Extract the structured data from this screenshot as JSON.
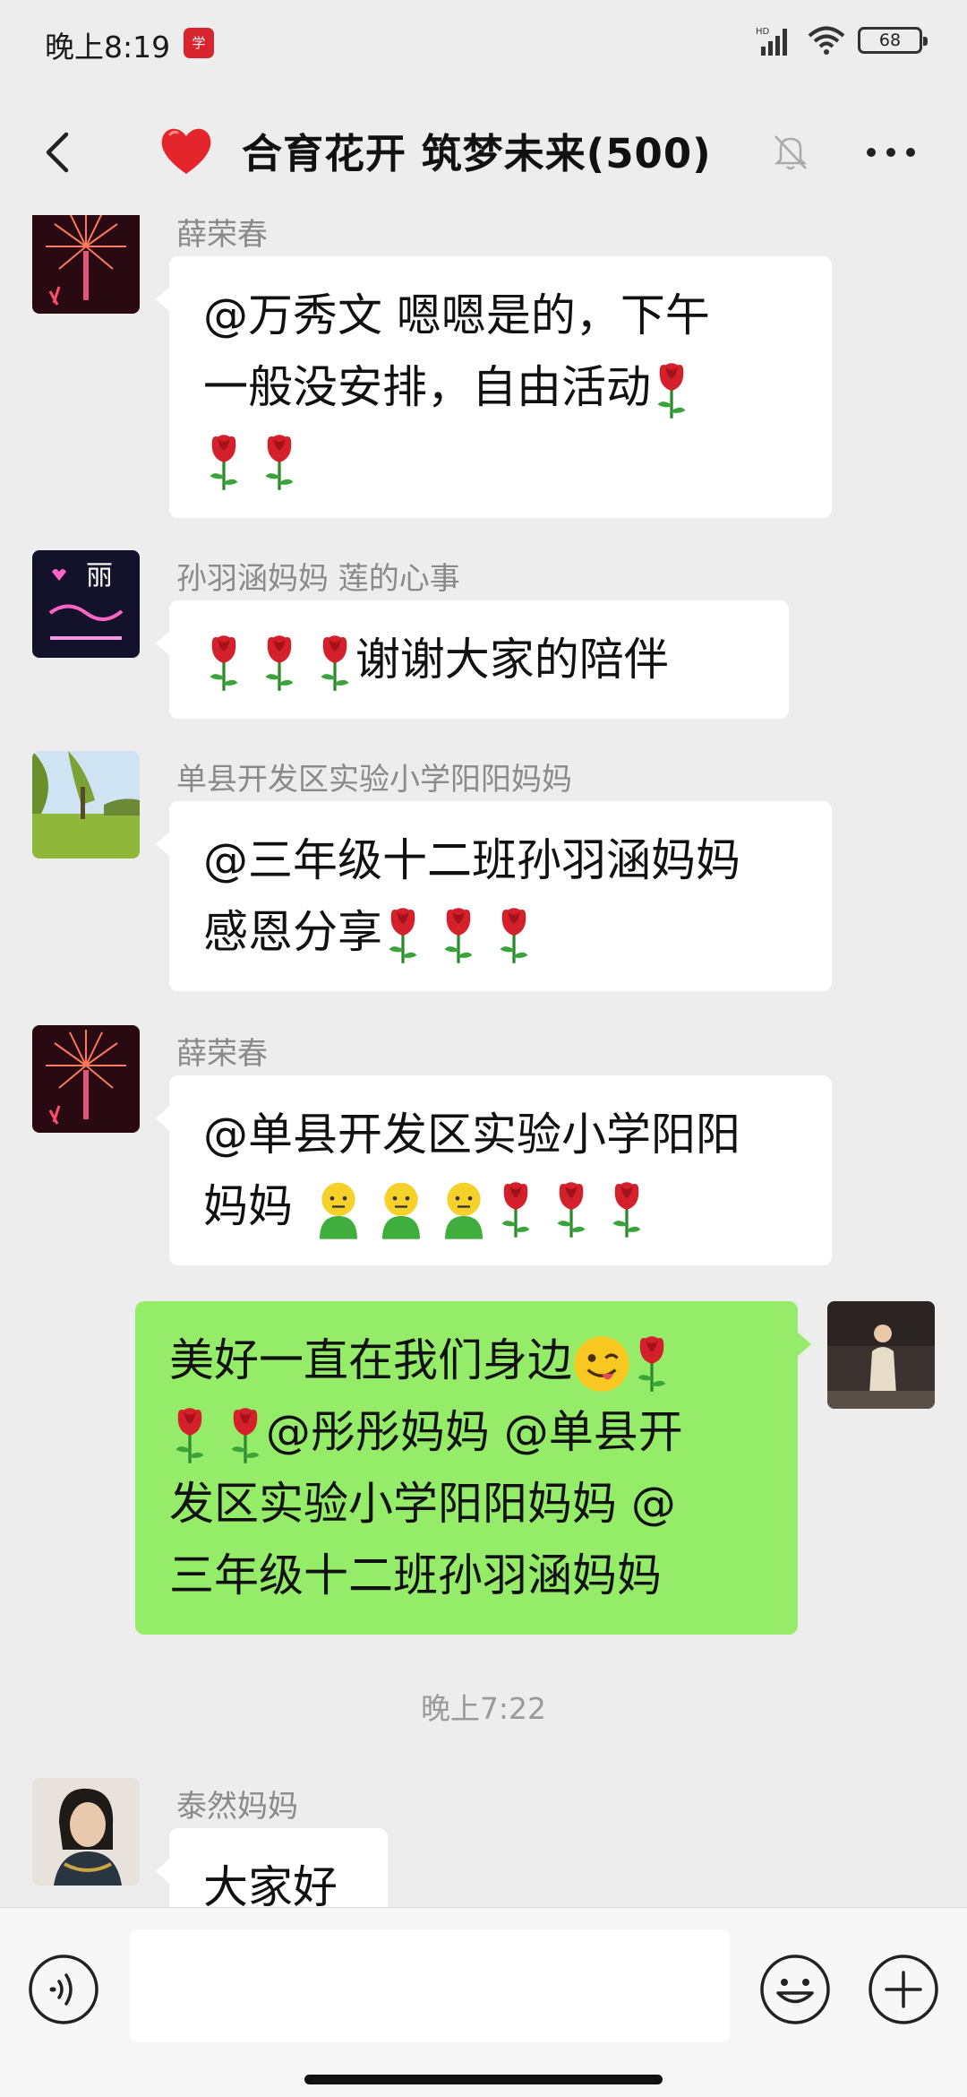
{
  "status_bar": {
    "time": "晚上8:19",
    "network": "HD",
    "battery": "68"
  },
  "header": {
    "title": "合育花开 筑梦未来(500)",
    "heart_icon": "red-heart",
    "muted": true
  },
  "messages": [
    {
      "sender": "薛荣春",
      "side": "left",
      "avatar": "fireworks",
      "lines": [
        "@万秀文  嗯嗯是的，下午",
        "一般没安排，自由活动",
        ""
      ],
      "roses": [
        1,
        0,
        2
      ]
    },
    {
      "sender": "孙羽涵妈妈  莲的心事",
      "side": "left",
      "avatar": "neon-li",
      "lines": [
        "谢谢大家的陪伴"
      ],
      "roses_prefix": 3
    },
    {
      "sender": "单县开发区实验小学阳阳妈妈",
      "side": "left",
      "avatar": "landscape",
      "lines": [
        "@三年级十二班孙羽涵妈妈",
        " 感恩分享"
      ],
      "roses": [
        0,
        3
      ]
    },
    {
      "sender": "薛荣春",
      "side": "left",
      "avatar": "fireworks",
      "lines": [
        "@单县开发区实验小学阳阳",
        "妈妈 "
      ],
      "people": 3,
      "roses": [
        0,
        3
      ]
    },
    {
      "side": "right",
      "avatar": "person",
      "lines": [
        "美好一直在我们身边",
        "@彤彤妈妈 @单县开",
        "发区实验小学阳阳妈妈  @",
        "三年级十二班孙羽涵妈妈"
      ]
    }
  ],
  "time_divider": "晚上7:22",
  "last_message": {
    "sender": "泰然妈妈",
    "avatar": "woman",
    "text": "大家好"
  },
  "input_bar": {
    "voice_icon": "voice-icon",
    "emoji_icon": "emoji-icon",
    "plus_icon": "plus-icon",
    "placeholder": ""
  },
  "colors": {
    "background": "#ededed",
    "bubble_self": "#95ec69",
    "bubble_other": "#ffffff",
    "name_gray": "#8a8a8a"
  }
}
